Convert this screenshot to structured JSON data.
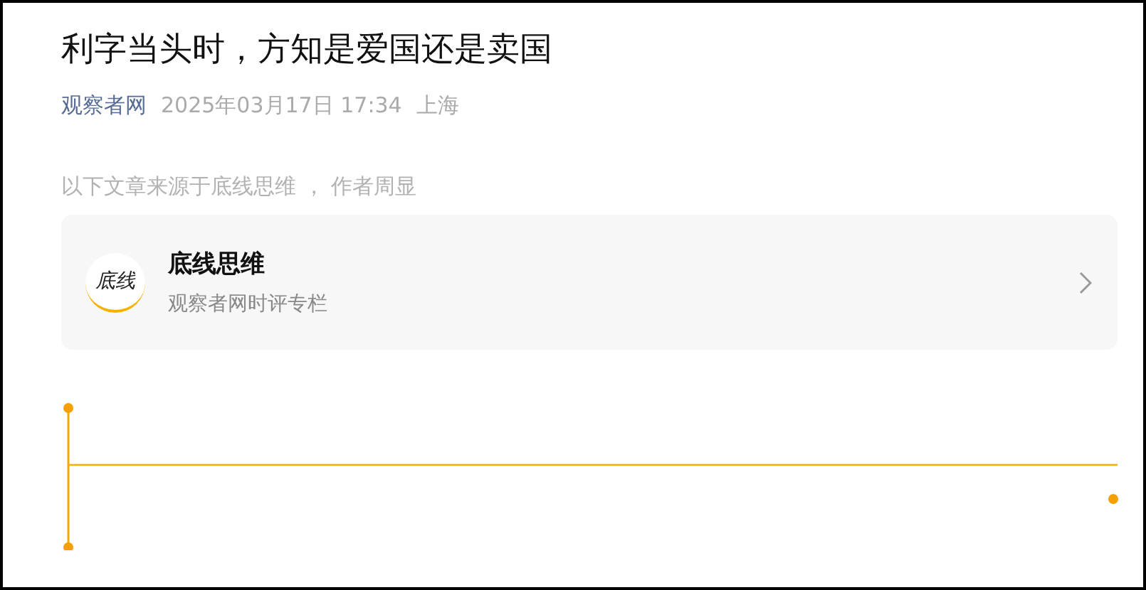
{
  "article": {
    "title": "利字当头时，方知是爱国还是卖国",
    "source": "观察者网",
    "date": "2025年03月17日 17:34",
    "location": "上海",
    "attribution": "以下文章来源于底线思维 ， 作者周显"
  },
  "account_card": {
    "logo_text": "底线",
    "name": "底线思维",
    "description": "观察者网时评专栏"
  }
}
